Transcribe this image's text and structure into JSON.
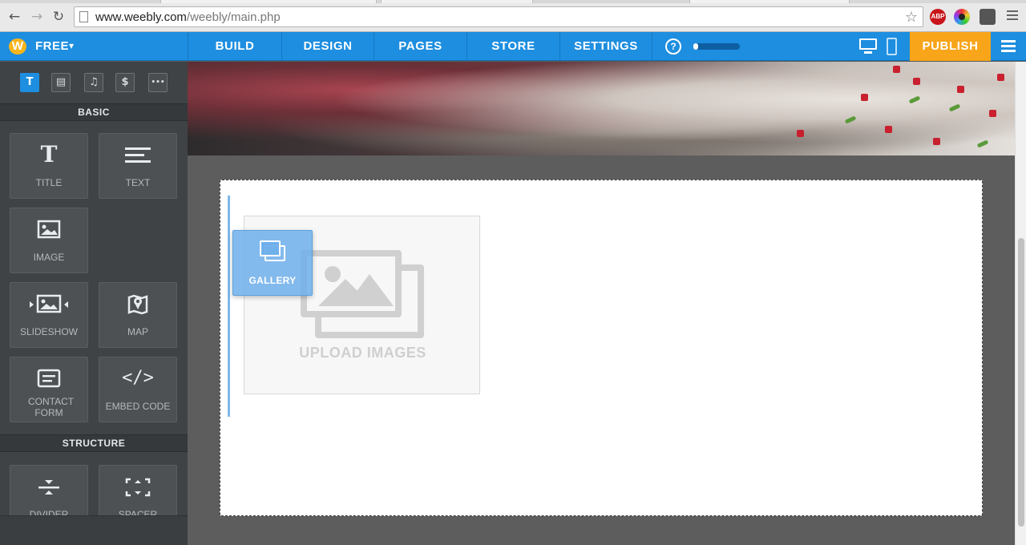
{
  "browser": {
    "url_host": "www.weebly.com",
    "url_path": "/weebly/main.php"
  },
  "topnav": {
    "plan_label": "FREE",
    "tabs": [
      {
        "label": "BUILD"
      },
      {
        "label": "DESIGN"
      },
      {
        "label": "PAGES"
      },
      {
        "label": "STORE"
      },
      {
        "label": "SETTINGS"
      }
    ],
    "help_label": "?",
    "progress_fraction": 0.1,
    "publish_label": "PUBLISH"
  },
  "sidebar": {
    "category_icons": [
      {
        "glyph": "T",
        "name": "text-category-icon"
      },
      {
        "glyph": "▤",
        "name": "layout-category-icon"
      },
      {
        "glyph": "♫",
        "name": "media-category-icon"
      },
      {
        "glyph": "$",
        "name": "commerce-category-icon"
      },
      {
        "glyph": "•••",
        "name": "more-category-icon"
      }
    ],
    "basic_heading": "BASIC",
    "basic_items": [
      {
        "label": "TITLE",
        "icon": "title-icon"
      },
      {
        "label": "TEXT",
        "icon": "text-lines-icon"
      },
      {
        "label": "IMAGE",
        "icon": "image-icon"
      },
      {
        "label": "SLIDESHOW",
        "icon": "slideshow-icon"
      },
      {
        "label": "MAP",
        "icon": "map-pin-icon"
      },
      {
        "label": "CONTACT FORM",
        "icon": "form-icon"
      },
      {
        "label": "EMBED CODE",
        "icon": "code-icon"
      }
    ],
    "structure_heading": "STRUCTURE",
    "structure_items": [
      {
        "label": "DIVIDER",
        "icon": "divider-icon"
      },
      {
        "label": "SPACER",
        "icon": "spacer-icon"
      }
    ]
  },
  "canvas": {
    "upload_label": "UPLOAD IMAGES",
    "drag_element_label": "GALLERY"
  },
  "colors": {
    "accent": "#1d8ee0",
    "publish": "#f8a51a",
    "sidebar": "#3f4346"
  }
}
